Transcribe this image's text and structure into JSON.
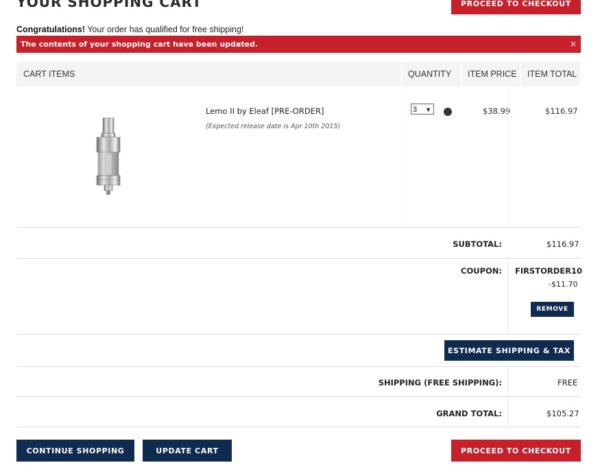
{
  "header": {
    "title": "YOUR SHOPPING CART",
    "proceed_label": "PROCEED TO CHECKOUT"
  },
  "notice": {
    "congrats_bold": "Congratulations!",
    "congrats_text": " Your order has qualified for free shipping!",
    "alert_text": "The contents of your shopping cart have been updated.",
    "alert_close": "×"
  },
  "table": {
    "headers": [
      "CART ITEMS",
      "QUANTITY",
      "ITEM PRICE",
      "ITEM TOTAL"
    ]
  },
  "items": [
    {
      "name": "Lemo II by Eleaf [PRE-ORDER]",
      "note": "(Expected release date is Apr 10th 2015)",
      "quantity": "3",
      "price": "$38.99",
      "total": "$116.97"
    }
  ],
  "summary": {
    "subtotal_label": "SUBTOTAL:",
    "subtotal_value": "$116.97",
    "coupon_label": "COUPON:",
    "coupon_code": "FIRSTORDER10",
    "coupon_discount": "-$11.70",
    "remove_label": "REMOVE",
    "estimate_label": "ESTIMATE SHIPPING & TAX",
    "shipping_label": "SHIPPING (FREE SHIPPING):",
    "shipping_value": "FREE",
    "grand_total_label": "GRAND TOTAL:",
    "grand_total_value": "$105.27"
  },
  "footer": {
    "continue_label": "CONTINUE SHOPPING",
    "update_label": "UPDATE CART",
    "proceed_label": "PROCEED TO CHECKOUT"
  },
  "colors": {
    "brand_red": "#c8202a",
    "brand_navy": "#0f2b4f"
  }
}
